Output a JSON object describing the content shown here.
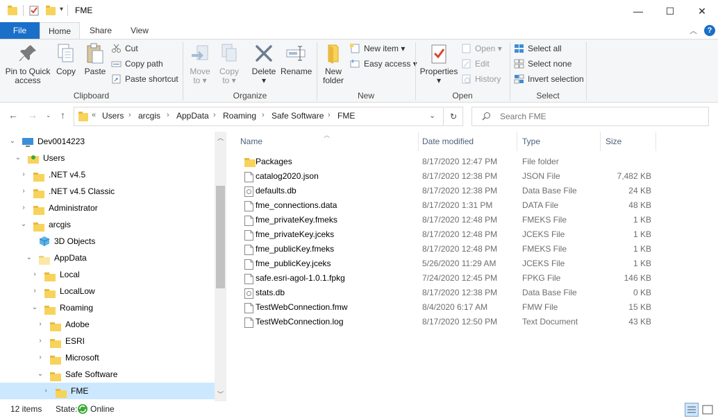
{
  "window": {
    "title": "FME",
    "minimize": "—",
    "maximize": "☐",
    "close": "✕"
  },
  "tabs": {
    "file": "File",
    "home": "Home",
    "share": "Share",
    "view": "View"
  },
  "ribbon": {
    "clipboard": {
      "label": "Clipboard",
      "pin": "Pin to Quick access",
      "pin_l1": "Pin to Quick",
      "pin_l2": "access",
      "copy": "Copy",
      "paste": "Paste",
      "cut": "Cut",
      "copy_path": "Copy path",
      "paste_shortcut": "Paste shortcut"
    },
    "organize": {
      "label": "Organize",
      "move_l1": "Move",
      "move_l2": "to",
      "copy_l1": "Copy",
      "copy_l2": "to",
      "delete": "Delete",
      "rename": "Rename"
    },
    "new": {
      "label": "New",
      "new_folder_l1": "New",
      "new_folder_l2": "folder",
      "new_item": "New item",
      "easy_access": "Easy access"
    },
    "open": {
      "label": "Open",
      "properties": "Properties",
      "open": "Open",
      "edit": "Edit",
      "history": "History"
    },
    "select": {
      "label": "Select",
      "select_all": "Select all",
      "select_none": "Select none",
      "invert_selection": "Invert selection"
    }
  },
  "address": {
    "breadcrumbs": [
      "Users",
      "arcgis",
      "AppData",
      "Roaming",
      "Safe Software",
      "FME"
    ],
    "overflow": "«",
    "search_placeholder": "Search FME"
  },
  "nav_tree": [
    {
      "label": "Dev0014223",
      "expanded": true
    },
    {
      "label": "Users",
      "expanded": true
    },
    {
      "label": ".NET v4.5",
      "expanded": false
    },
    {
      "label": ".NET v4.5 Classic",
      "expanded": false
    },
    {
      "label": "Administrator",
      "expanded": false
    },
    {
      "label": "arcgis",
      "expanded": true
    },
    {
      "label": "3D Objects",
      "expanded": false
    },
    {
      "label": "AppData",
      "expanded": true
    },
    {
      "label": "Local",
      "expanded": false
    },
    {
      "label": "LocalLow",
      "expanded": false
    },
    {
      "label": "Roaming",
      "expanded": true
    },
    {
      "label": "Adobe",
      "expanded": false
    },
    {
      "label": "ESRI",
      "expanded": false
    },
    {
      "label": "Microsoft",
      "expanded": false
    },
    {
      "label": "Safe Software",
      "expanded": true
    },
    {
      "label": "FME",
      "expanded": false
    }
  ],
  "columns": {
    "name": "Name",
    "date": "Date modified",
    "type": "Type",
    "size": "Size"
  },
  "files": [
    {
      "name": "Packages",
      "date": "8/17/2020 12:47 PM",
      "type": "File folder",
      "size": ""
    },
    {
      "name": "catalog2020.json",
      "date": "8/17/2020 12:38 PM",
      "type": "JSON File",
      "size": "7,482 KB"
    },
    {
      "name": "defaults.db",
      "date": "8/17/2020 12:38 PM",
      "type": "Data Base File",
      "size": "24 KB"
    },
    {
      "name": "fme_connections.data",
      "date": "8/17/2020 1:31 PM",
      "type": "DATA File",
      "size": "48 KB"
    },
    {
      "name": "fme_privateKey.fmeks",
      "date": "8/17/2020 12:48 PM",
      "type": "FMEKS File",
      "size": "1 KB"
    },
    {
      "name": "fme_privateKey.jceks",
      "date": "8/17/2020 12:48 PM",
      "type": "JCEKS File",
      "size": "1 KB"
    },
    {
      "name": "fme_publicKey.fmeks",
      "date": "8/17/2020 12:48 PM",
      "type": "FMEKS File",
      "size": "1 KB"
    },
    {
      "name": "fme_publicKey.jceks",
      "date": "5/26/2020 11:29 AM",
      "type": "JCEKS File",
      "size": "1 KB"
    },
    {
      "name": "safe.esri-agol-1.0.1.fpkg",
      "date": "7/24/2020 12:45 PM",
      "type": "FPKG File",
      "size": "146 KB"
    },
    {
      "name": "stats.db",
      "date": "8/17/2020 12:38 PM",
      "type": "Data Base File",
      "size": "0 KB"
    },
    {
      "name": "TestWebConnection.fmw",
      "date": "8/4/2020 6:17 AM",
      "type": "FMW File",
      "size": "15 KB"
    },
    {
      "name": "TestWebConnection.log",
      "date": "8/17/2020 12:50 PM",
      "type": "Text Document",
      "size": "43 KB"
    }
  ],
  "status": {
    "items": "12 items",
    "state_label": "State:",
    "state_value": "Online"
  }
}
